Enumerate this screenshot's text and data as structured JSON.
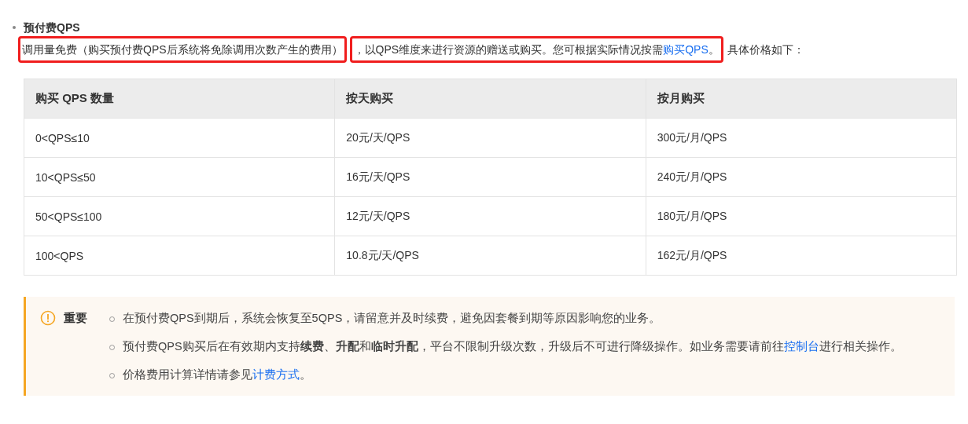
{
  "section": {
    "title": "预付费QPS",
    "intro": [
      {
        "highlighted": true,
        "runs": [
          {
            "kind": "text",
            "text": "调用量免费（购买预付费QPS后系统将免除调用次数产生的费用）"
          }
        ]
      },
      {
        "highlighted": true,
        "runs": [
          {
            "kind": "text",
            "text": "，以QPS维度来进行资源的赠送或购买。您可根据实际情况按需"
          },
          {
            "kind": "link",
            "text": "购买QPS"
          },
          {
            "kind": "text",
            "text": "。"
          }
        ]
      },
      {
        "highlighted": false,
        "runs": [
          {
            "kind": "text",
            "text": "具体价格如下："
          }
        ]
      }
    ],
    "table": {
      "columns": [
        "购买 QPS 数量",
        "按天购买",
        "按月购买"
      ],
      "rows": [
        [
          "0<QPS≤10",
          "20元/天/QPS",
          "300元/月/QPS"
        ],
        [
          "10<QPS≤50",
          "16元/天/QPS",
          "240元/月/QPS"
        ],
        [
          "50<QPS≤100",
          "12元/天/QPS",
          "180元/月/QPS"
        ],
        [
          "100<QPS",
          "10.8元/天/QPS",
          "162元/月/QPS"
        ]
      ]
    },
    "notice": {
      "label": "重要",
      "items": [
        [
          {
            "kind": "text",
            "text": "在预付费QPS到期后，系统会恢复至5QPS，请留意并及时续费，避免因套餐到期等原因影响您的业务。"
          }
        ],
        [
          {
            "kind": "text",
            "text": "预付费QPS购买后在有效期内支持"
          },
          {
            "kind": "bold",
            "text": "续费"
          },
          {
            "kind": "text",
            "text": "、"
          },
          {
            "kind": "bold",
            "text": "升配"
          },
          {
            "kind": "text",
            "text": "和"
          },
          {
            "kind": "bold",
            "text": "临时升配"
          },
          {
            "kind": "text",
            "text": "，平台不限制升级次数，升级后不可进行降级操作。如业务需要请前往"
          },
          {
            "kind": "link",
            "text": "控制台"
          },
          {
            "kind": "text",
            "text": "进行相关操作。"
          }
        ],
        [
          {
            "kind": "text",
            "text": "价格费用计算详情请参见"
          },
          {
            "kind": "link",
            "text": "计费方式"
          },
          {
            "kind": "text",
            "text": "。"
          }
        ]
      ]
    }
  }
}
